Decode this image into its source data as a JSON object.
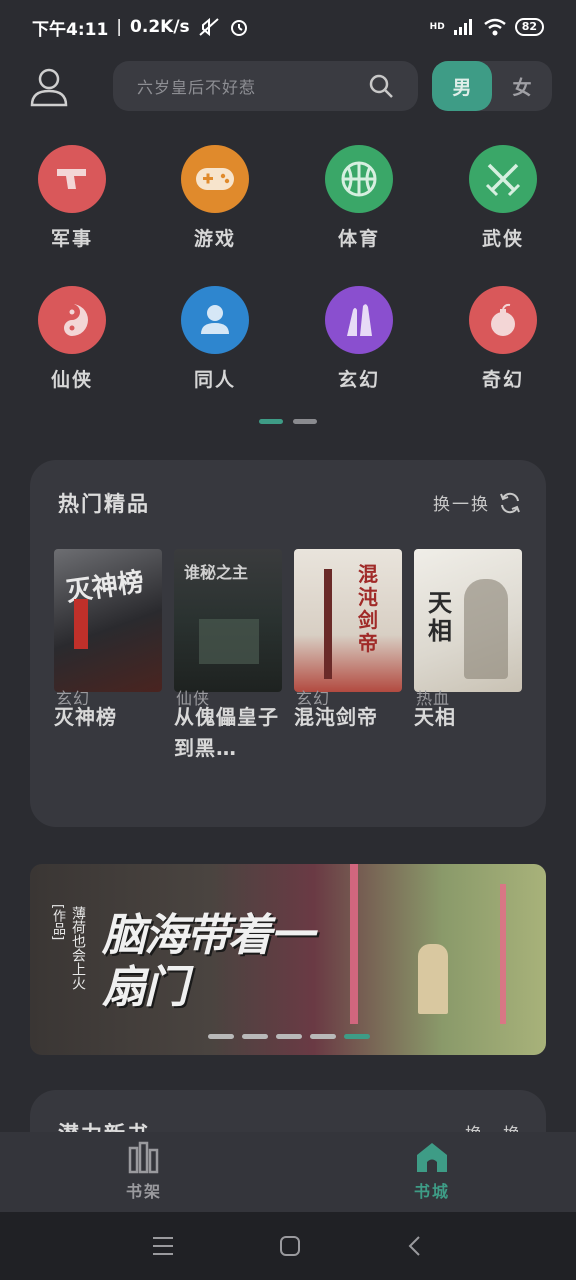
{
  "status_bar": {
    "time": "下午4:11",
    "network_speed": "0.2K/s",
    "hd_label": "HD",
    "battery": "82"
  },
  "header": {
    "search_placeholder": "六岁皇后不好惹",
    "gender_male": "男",
    "gender_female": "女"
  },
  "categories": [
    {
      "label": "军事",
      "icon": "gun-icon",
      "color": "#d9585a"
    },
    {
      "label": "游戏",
      "icon": "gamepad-icon",
      "color": "#e08a2c"
    },
    {
      "label": "体育",
      "icon": "basketball-icon",
      "color": "#3aa768"
    },
    {
      "label": "武侠",
      "icon": "crossed-swords-icon",
      "color": "#3aa768"
    },
    {
      "label": "仙侠",
      "icon": "yin-yang-icon",
      "color": "#d9585a"
    },
    {
      "label": "同人",
      "icon": "person-icon",
      "color": "#2e86cf"
    },
    {
      "label": "玄幻",
      "icon": "magic-hand-icon",
      "color": "#8a4fcf"
    },
    {
      "label": "奇幻",
      "icon": "bomb-icon",
      "color": "#d9585a"
    }
  ],
  "hot": {
    "title": "热门精品",
    "refresh_label": "换一换",
    "books": [
      {
        "title": "灭神榜",
        "genre": "玄幻",
        "cover_text": "灭神榜"
      },
      {
        "title": "从傀儡皇子到黑…",
        "genre": "仙侠",
        "cover_text": "谁秘之主"
      },
      {
        "title": "混沌剑帝",
        "genre": "玄幻",
        "cover_text": "混沌剑帝"
      },
      {
        "title": "天相",
        "genre": "热血",
        "cover_text": "天相"
      }
    ]
  },
  "banner": {
    "title": "脑海带着一扇门",
    "author": "薄荷也会上火",
    "tag": "[作品]"
  },
  "next_section": {
    "title": "潜力新书",
    "refresh_label": "换一换"
  },
  "bottom_nav": {
    "bookshelf": "书架",
    "bookstore": "书城"
  },
  "colors": {
    "accent": "#3e9c86",
    "background": "#2b2c31",
    "card": "#37383e"
  }
}
